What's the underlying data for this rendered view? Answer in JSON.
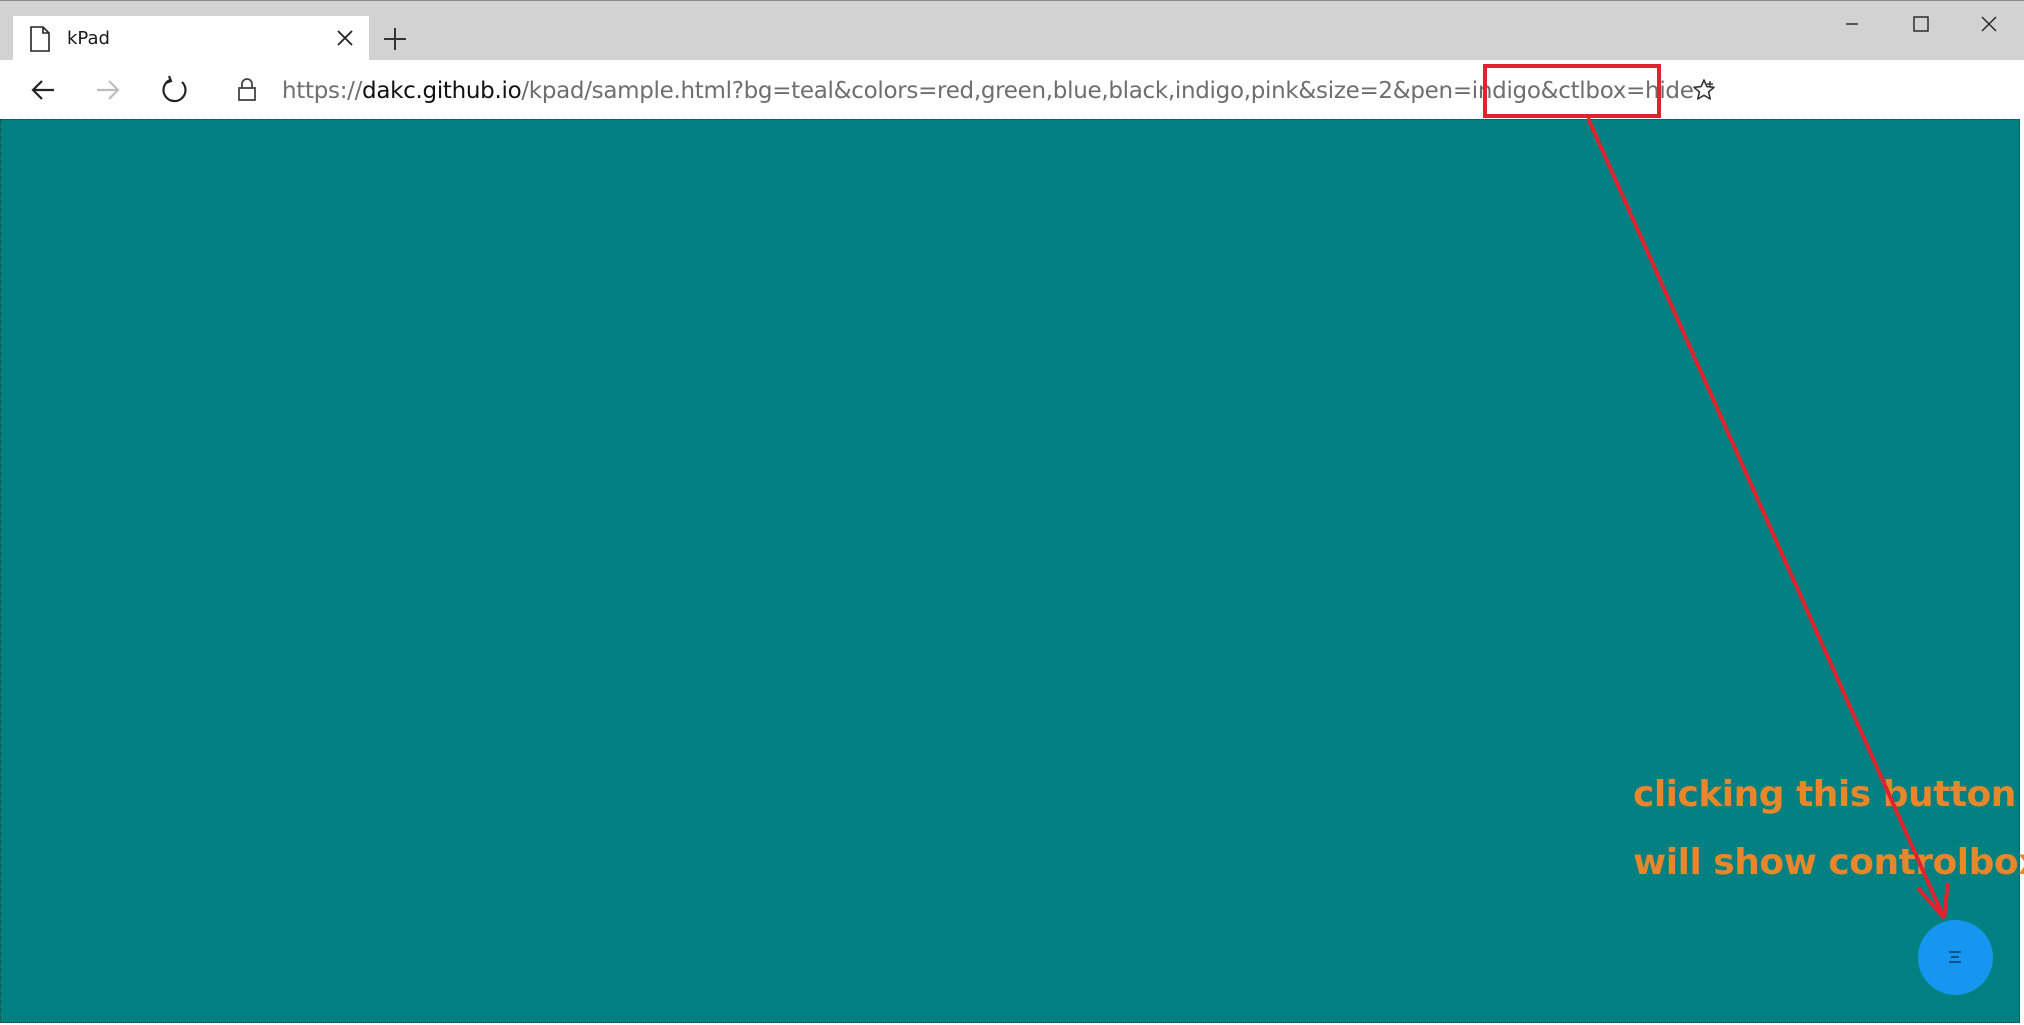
{
  "tab": {
    "title": "kPad"
  },
  "address": {
    "scheme": "https://",
    "host": "dakc.github.io",
    "path": "/kpad/sample.html?bg=teal&colors=red,green,blue,black,indigo,pink&size=2&pen=indigo&ctlbox=hide"
  },
  "page": {
    "background": "#008080"
  },
  "annotation": {
    "line1": "clicking this button",
    "line2": "will show controlbox",
    "color": "#e8862b",
    "arrow_color": "#e0232e"
  },
  "icons": {
    "tab": "page-icon",
    "close": "close-icon",
    "new_tab": "plus-icon",
    "back": "arrow-left-icon",
    "forward": "arrow-right-icon",
    "refresh": "refresh-icon",
    "lock": "lock-icon",
    "favorite": "star-icon",
    "menu": "hamburger-menu-icon"
  }
}
